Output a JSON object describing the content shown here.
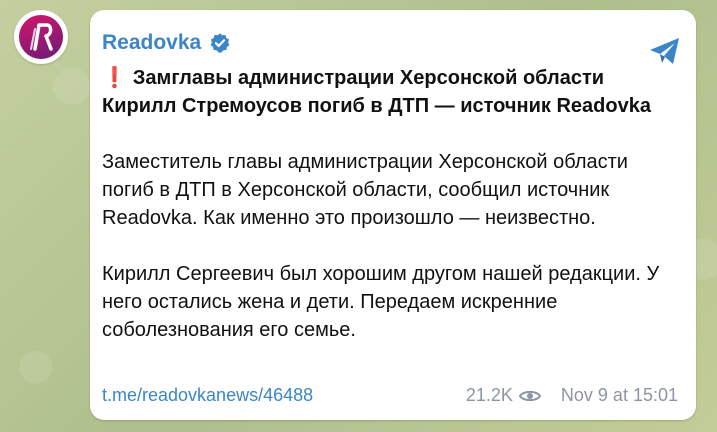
{
  "channel": {
    "name": "Readovka",
    "verified": true,
    "avatar_colors": [
      "#d2186a",
      "#6b1a7a"
    ]
  },
  "post": {
    "headline_emoji": "❗",
    "headline": "Замглавы администрации Херсонской области Кирилл Стремоусов погиб в ДТП — источник Readovka",
    "paragraph1": "Заместитель главы администрации Херсонской области погиб в ДТП в Херсонской области, сообщил источник Readovka. Как именно это произошло — неизвестно.",
    "paragraph2": "Кирилл Сергеевич был хорошим другом нашей редакции. У него остались жена и дети. Передаем искренние соболезнования его семье."
  },
  "footer": {
    "link": "t.me/readovkanews/46488",
    "views": "21.2K",
    "timestamp": "Nov 9 at 15:01"
  },
  "colors": {
    "accent": "#3a86c8",
    "meta": "#8c96a2",
    "alert": "#d8252e"
  }
}
